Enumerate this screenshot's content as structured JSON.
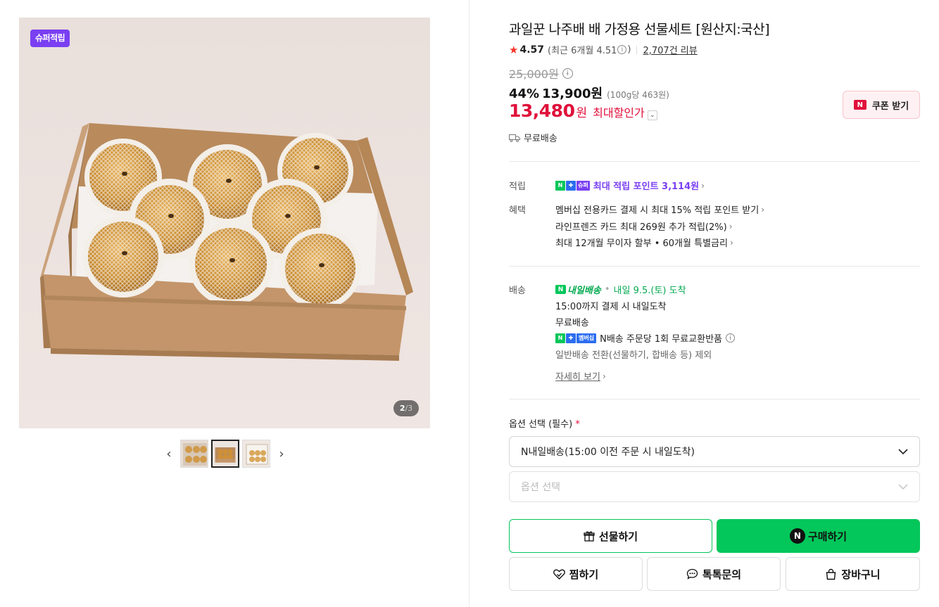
{
  "colors": {
    "brand_green": "#03c75a",
    "sale_red": "#e0103b",
    "super_purple": "#7a3ff2"
  },
  "gallery": {
    "badge": "슈퍼적립",
    "counter_current": "2",
    "counter_total": "/3",
    "thumbnails": [
      "thumb-1",
      "thumb-2",
      "thumb-3"
    ],
    "active_thumbnail": 2
  },
  "product": {
    "title": "과일꾼 나주배 배 가정용 선물세트 [원산지:국산]",
    "rating": "4.57",
    "recent_rating": "(최근 6개월 4.51",
    "recent_rating_close": ")",
    "review_count": "2,707건 리뷰",
    "original_price": "25,000원",
    "discount_pct": "44%",
    "sale_price": "13,900원",
    "unit_price": "(100g당 463원)",
    "max_discount_price": "13,480",
    "max_discount_won": "원",
    "max_discount_label": "최대할인가",
    "coupon_button": "쿠폰 받기",
    "shipping_fee": "무료배송"
  },
  "points": {
    "label": "적립",
    "badge_super": "슈퍼",
    "text": "최대 적립 포인트 3,114원"
  },
  "benefits": {
    "label": "혜택",
    "items": [
      "멤버십 전용카드 결제 시 최대 15% 적립 포인트 받기",
      "라인프렌즈 카드 최대 269원 추가 적립(2%)",
      "최대 12개월 무이자 할부 • 60개월 특별금리"
    ]
  },
  "delivery": {
    "label": "배송",
    "service": "내일배송",
    "arrival": "내일 9.5.(토) 도착",
    "cutoff": "15:00까지 결제 시 내일도착",
    "fee": "무료배송",
    "membership_badge": "멤버십",
    "exchange": "N배송 주문당 1회 무료교환반품",
    "exclusion": "일반배송 전환(선물하기, 합배송 등) 제외",
    "detail_link": "자세히 보기"
  },
  "options": {
    "label": "옵션 선택 (필수)",
    "required_mark": "*",
    "selected_delivery": "N내일배송(15:00 이전 주문 시 내일도착)",
    "placeholder": "옵션 선택"
  },
  "actions": {
    "gift": "선물하기",
    "buy": "구매하기",
    "wish": "찜하기",
    "talk": "톡톡문의",
    "cart": "장바구니"
  }
}
